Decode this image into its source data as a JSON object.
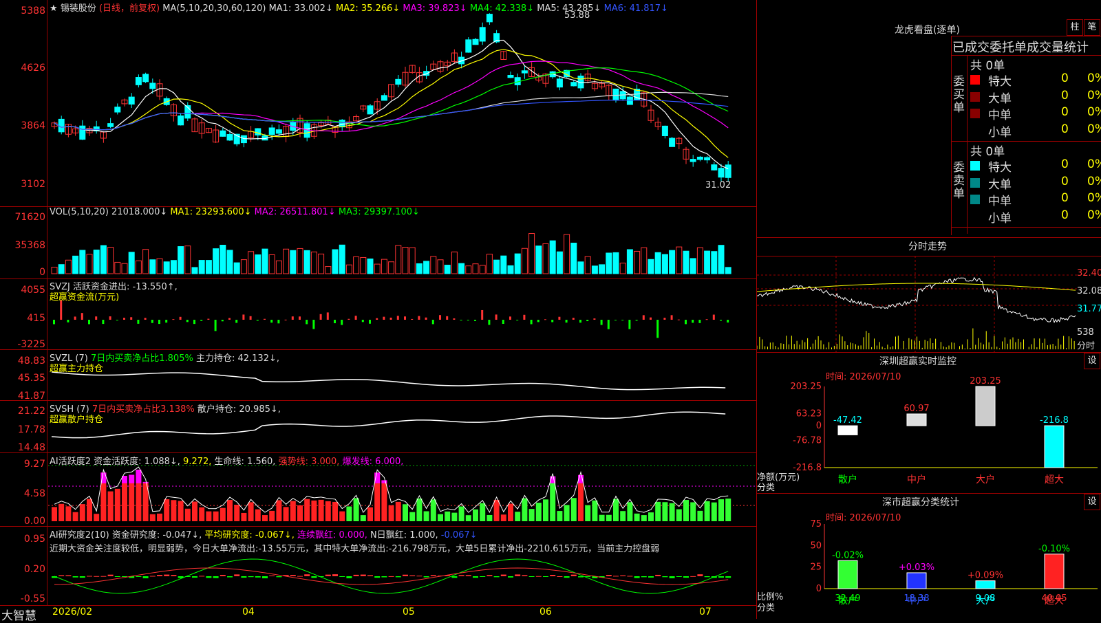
{
  "header": {
    "star": "★",
    "stock": "锡装股份",
    "mode": "(日线，前复权)",
    "ma_def": "MA(5,10,20,30,60,120)",
    "ma1": "MA1: 33.002↓",
    "ma2": "MA2: 35.266↓",
    "ma3": "MA3: 39.823↓",
    "ma4": "MA4: 42.338↓",
    "ma5": "MA5: 43.285↓",
    "ma6": "MA6: 41.817↓"
  },
  "price_axis": [
    "5388",
    "4626",
    "3864",
    "3102"
  ],
  "price_marks": {
    "high": "53.88",
    "low": "31.02"
  },
  "vol": {
    "title": "VOL(5,10,20)",
    "v": "21018.000↓",
    "ma1": "MA1: 23293.600↓",
    "ma2": "MA2: 26511.801↓",
    "ma3": "MA3: 29397.100↓",
    "axis": [
      "71620",
      "35368",
      "0"
    ]
  },
  "svzj": {
    "title": "SVZJ",
    "text": "活跃资金进出: -13.550↑,",
    "sub": "超赢资金流(万元)",
    "axis": [
      "4055",
      "415",
      "-3225"
    ]
  },
  "svzl": {
    "title": "SVZL (7)",
    "text": "7日内买卖净占比1.805%",
    "hold": "主力持仓: 42.132↓,",
    "sub": "超赢主力持仓",
    "axis": [
      "48.83",
      "45.35",
      "41.87"
    ]
  },
  "svsh": {
    "title": "SVSH (7)",
    "text": "7日内买卖净占比3.138%",
    "hold": "散户持仓: 20.985↓,",
    "sub": "超赢散户持仓",
    "axis": [
      "21.22",
      "17.78",
      "14.48"
    ]
  },
  "ai1": {
    "title": "AI活跃度2",
    "a": "资金活跃度: 1.088↓,",
    "b": "9.272,",
    "c": "生命线: 1.560,",
    "d": "强势线: 3.000,",
    "e": "爆发线: 6.000,",
    "axis": [
      "9.27",
      "4.58",
      "0.00"
    ]
  },
  "ai2": {
    "title": "AI研究度2(10)",
    "a": "资金研究度: -0.047↓,",
    "b": "平均研究度: -0.067↓,",
    "c": "连续飘红: 0.000,",
    "d": "N日飘红: 1.000,",
    "e": "-0.067↓",
    "desc": "近期大资金关注度较低，明显弱势，今日大单净流出:-13.55万元，其中特大单净流出:-216.798万元，大单5日累计净出-2210.615万元，当前主力控盘弱",
    "axis": [
      "0.95",
      "0.20",
      "-0.55"
    ]
  },
  "xaxis": [
    "2026/02",
    "04",
    "05",
    "06",
    "07"
  ],
  "brand": "大智慧",
  "lhb": {
    "title": "龙虎看盘(逐单)",
    "btn1": "柱",
    "btn2": "笔",
    "subtitle": "已成交委托单成交量统计",
    "buy_label": "委买单",
    "sell_label": "委卖单",
    "buy_total": "共 0单",
    "sell_total": "共 0单",
    "buy": [
      {
        "name": "特大",
        "v": "0",
        "p": "0%",
        "color": "#ff0000"
      },
      {
        "name": "大单",
        "v": "0",
        "p": "0%",
        "color": "#880000"
      },
      {
        "name": "中单",
        "v": "0",
        "p": "0%",
        "color": "#880000"
      },
      {
        "name": "小单",
        "v": "0",
        "p": "0%",
        "color": ""
      }
    ],
    "sell": [
      {
        "name": "特大",
        "v": "0",
        "p": "0%",
        "color": "#00ffff"
      },
      {
        "name": "大单",
        "v": "0",
        "p": "0%",
        "color": "#008888"
      },
      {
        "name": "中单",
        "v": "0",
        "p": "0%",
        "color": "#008888"
      },
      {
        "name": "小单",
        "v": "0",
        "p": "0%",
        "color": ""
      }
    ]
  },
  "fs": {
    "title": "分时走势",
    "axis": [
      "32.40",
      "32.08",
      "31.77"
    ],
    "vol": "538",
    "vol_unit": "分时"
  },
  "sz": {
    "title": "深圳超赢实时监控",
    "btn": "设",
    "time": "时间: 2026/07/10",
    "axis": [
      "203.25",
      "63.23",
      "0",
      "-76.78",
      "-216.8"
    ],
    "ylabel": "净额(万元)",
    "xlabel": "分类",
    "chart_data": {
      "type": "bar",
      "categories": [
        "散户",
        "中户",
        "大户",
        "超大"
      ],
      "values": [
        -47.42,
        60.97,
        203.25,
        -216.8
      ],
      "ylim": [
        -216.8,
        203.25
      ]
    }
  },
  "sh": {
    "title": "深市超赢分类统计",
    "btn": "设",
    "time": "时间: 2026/07/10",
    "axis": [
      "75",
      "50",
      "25",
      "0"
    ],
    "ylabel": "比例%",
    "xlabel": "分类",
    "chart_data": {
      "type": "bar",
      "categories": [
        "散户",
        "中户",
        "大户",
        "超大"
      ],
      "values": [
        32.49,
        18.38,
        9.08,
        40.05
      ],
      "changes": [
        "-0.02%",
        "+0.03%",
        "+0.09%",
        "-0.10%"
      ],
      "ylim": [
        0,
        75
      ]
    }
  }
}
